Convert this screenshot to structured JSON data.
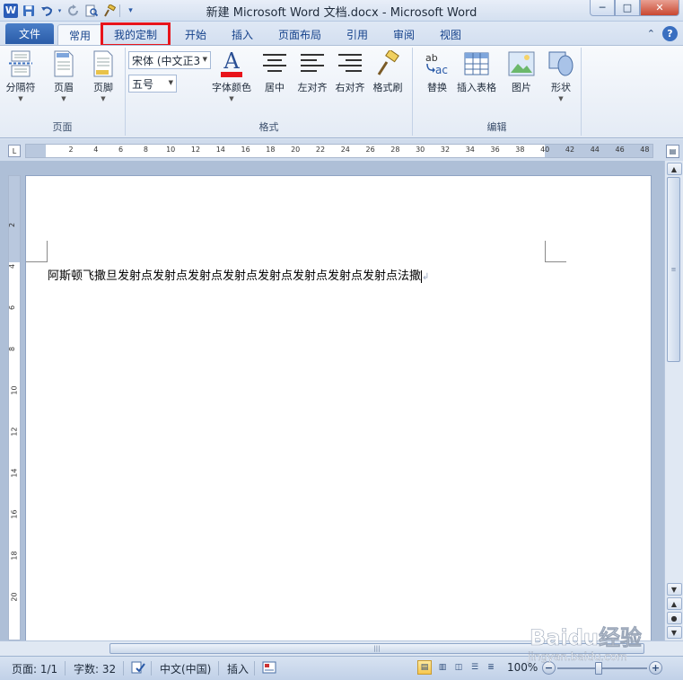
{
  "window": {
    "title": "新建 Microsoft Word 文档.docx - Microsoft Word",
    "minimize": "─",
    "maximize": "□",
    "close": "✕"
  },
  "qat": {
    "logo": "W",
    "items": [
      "save-icon",
      "undo-icon",
      "redo-icon",
      "print-preview-icon",
      "format-painter-icon",
      "customize-icon"
    ]
  },
  "tabs": {
    "file": "文件",
    "items": [
      "常用",
      "我的定制",
      "开始",
      "插入",
      "页面布局",
      "引用",
      "审阅",
      "视图"
    ],
    "active": "常用",
    "highlighted": "我的定制",
    "highlight_color": "#e8141b"
  },
  "ribbon": {
    "page_group": {
      "label": "页面",
      "buttons": [
        "分隔符",
        "页眉",
        "页脚"
      ]
    },
    "format_group": {
      "label": "格式",
      "font_name": "宋体 (中文正3",
      "font_size": "五号",
      "font_color_label": "字体颜色",
      "font_color": "#e8141b",
      "center": "居中",
      "align_left": "左对齐",
      "align_right": "右对齐",
      "format_painter": "格式刷"
    },
    "edit_group": {
      "label": "编辑",
      "buttons": [
        "替换",
        "插入表格",
        "图片",
        "形状"
      ]
    }
  },
  "ruler": {
    "marks": [
      "2",
      "4",
      "6",
      "8",
      "10",
      "12",
      "14",
      "16",
      "18",
      "20",
      "22",
      "24",
      "26",
      "28",
      "30",
      "32",
      "34",
      "36",
      "38",
      "40",
      "42",
      "44",
      "46",
      "48"
    ],
    "vmarks": [
      "2",
      "4",
      "6",
      "8",
      "10",
      "12",
      "14",
      "16",
      "18",
      "20"
    ]
  },
  "document": {
    "text": "阿斯顿飞撒旦发射点发射点发射点发射点发射点发射点发射点发射点法撒",
    "paragraph_mark": "↲"
  },
  "status": {
    "page": "页面: 1/1",
    "words": "字数: 32",
    "language": "中文(中国)",
    "insert_mode": "插入",
    "zoom": "100%"
  },
  "watermark": {
    "brand": "Baidu经验",
    "url": "jingyan.baidu.com"
  }
}
